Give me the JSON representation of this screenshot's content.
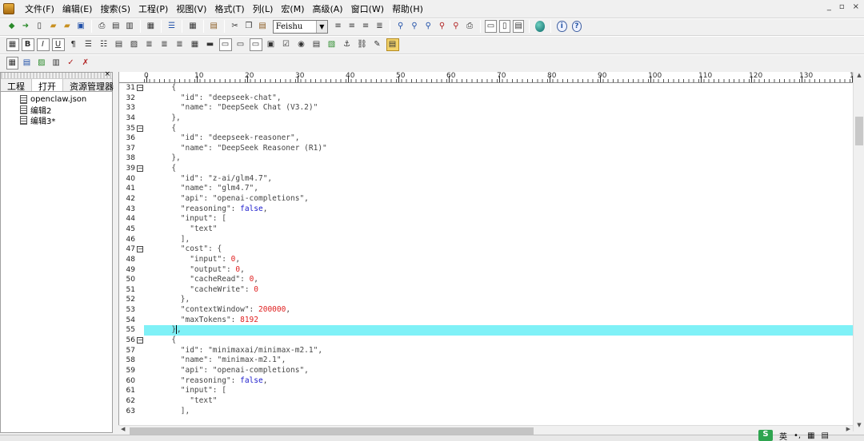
{
  "menubar": {
    "items": [
      "文件(F)",
      "编辑(E)",
      "搜索(S)",
      "工程(P)",
      "视图(V)",
      "格式(T)",
      "列(L)",
      "宏(M)",
      "高级(A)",
      "窗口(W)",
      "帮助(H)"
    ],
    "window_buttons": [
      "_",
      "▫",
      "×"
    ]
  },
  "toolbar": {
    "font_name": "Feishu"
  },
  "left_panel": {
    "close": "×",
    "tabs": [
      "工程",
      "打开",
      "资源管理器"
    ],
    "active_tab": 1,
    "files": [
      "openclaw.json",
      "编辑2",
      "编辑3*"
    ]
  },
  "ruler": {
    "labels": [
      "0",
      "10",
      "20",
      "30",
      "40",
      "50",
      "60",
      "70",
      "80",
      "90",
      "100",
      "110",
      "120",
      "130",
      "1"
    ]
  },
  "editor": {
    "highlight_line": 55,
    "lines": [
      {
        "n": "31",
        "fold": true,
        "html": "      {"
      },
      {
        "n": "32",
        "fold": false,
        "html": "        \"id\": \"deepseek-chat\","
      },
      {
        "n": "33",
        "fold": false,
        "html": "        \"name\": \"DeepSeek Chat (V3.2)\""
      },
      {
        "n": "34",
        "fold": false,
        "html": "      },"
      },
      {
        "n": "35",
        "fold": true,
        "html": "      {"
      },
      {
        "n": "36",
        "fold": false,
        "html": "        \"id\": \"deepseek-reasoner\","
      },
      {
        "n": "37",
        "fold": false,
        "html": "        \"name\": \"DeepSeek Reasoner (R1)\""
      },
      {
        "n": "38",
        "fold": false,
        "html": "      },"
      },
      {
        "n": "39",
        "fold": true,
        "html": "      {"
      },
      {
        "n": "40",
        "fold": false,
        "html": "        \"id\": \"z-ai/glm4.7\","
      },
      {
        "n": "41",
        "fold": false,
        "html": "        \"name\": \"glm4.7\","
      },
      {
        "n": "42",
        "fold": false,
        "html": "        \"api\": \"openai-completions\","
      },
      {
        "n": "43",
        "fold": false,
        "html": "        \"reasoning\": <span class=\"kw\">false</span>,"
      },
      {
        "n": "44",
        "fold": false,
        "html": "        \"input\": ["
      },
      {
        "n": "45",
        "fold": false,
        "html": "          \"text\""
      },
      {
        "n": "46",
        "fold": false,
        "html": "        ],"
      },
      {
        "n": "47",
        "fold": true,
        "html": "        \"cost\": {"
      },
      {
        "n": "48",
        "fold": false,
        "html": "          \"input\": <span class=\"nm\">0</span>,"
      },
      {
        "n": "49",
        "fold": false,
        "html": "          \"output\": <span class=\"nm\">0</span>,"
      },
      {
        "n": "50",
        "fold": false,
        "html": "          \"cacheRead\": <span class=\"nm\">0</span>,"
      },
      {
        "n": "51",
        "fold": false,
        "html": "          \"cacheWrite\": <span class=\"nm\">0</span>"
      },
      {
        "n": "52",
        "fold": false,
        "html": "        },"
      },
      {
        "n": "53",
        "fold": false,
        "html": "        \"contextWindow\": <span class=\"nm\">200000</span>,"
      },
      {
        "n": "54",
        "fold": false,
        "html": "        \"maxTokens\": <span class=\"nm\">8192</span>"
      },
      {
        "n": "55",
        "fold": false,
        "html": "      }<span class=\"caret\"></span>,"
      },
      {
        "n": "56",
        "fold": true,
        "html": "      {"
      },
      {
        "n": "57",
        "fold": false,
        "html": "        \"id\": \"minimaxai/minimax-m2.1\","
      },
      {
        "n": "58",
        "fold": false,
        "html": "        \"name\": \"minimax-m2.1\","
      },
      {
        "n": "59",
        "fold": false,
        "html": "        \"api\": \"openai-completions\","
      },
      {
        "n": "60",
        "fold": false,
        "html": "        \"reasoning\": <span class=\"kw\">false</span>,"
      },
      {
        "n": "61",
        "fold": false,
        "html": "        \"input\": ["
      },
      {
        "n": "62",
        "fold": false,
        "html": "          \"text\""
      },
      {
        "n": "63",
        "fold": false,
        "html": "        ],"
      }
    ]
  },
  "ime": {
    "logo": "S",
    "mode": "英"
  },
  "colors": {
    "highlight": "#7ff1f7",
    "keyword": "#1a1acc",
    "number": "#e02020"
  }
}
